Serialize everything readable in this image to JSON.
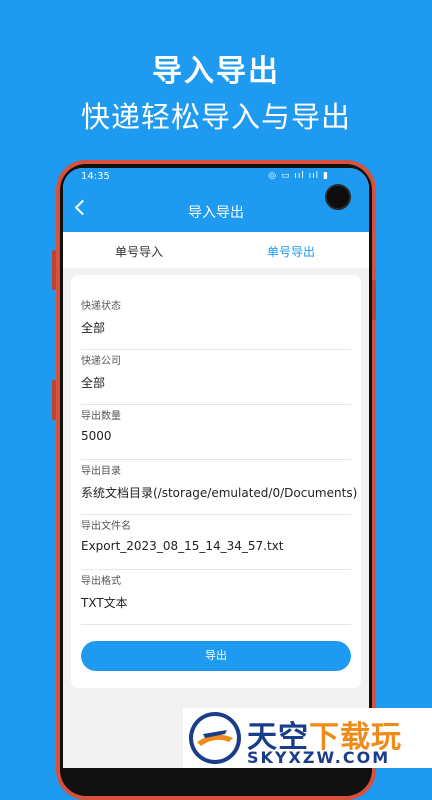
{
  "promo": {
    "title": "导入导出",
    "subtitle": "快递轻松导入与导出"
  },
  "status_bar": {
    "time": "14:35",
    "icons": "◎ ▭ ııl ııl ▮"
  },
  "nav": {
    "title": "导入导出",
    "back_icon": "chevron-left-icon"
  },
  "tabs": [
    {
      "label": "单号导入",
      "active": false
    },
    {
      "label": "单号导出",
      "active": true
    }
  ],
  "form": {
    "fields": [
      {
        "label": "快递状态",
        "value": "全部"
      },
      {
        "label": "快递公司",
        "value": "全部"
      },
      {
        "label": "导出数量",
        "value": "5000"
      },
      {
        "label": "导出目录",
        "value": "系统文档目录(/storage/emulated/0/Documents)"
      },
      {
        "label": "导出文件名",
        "value": "Export_2023_08_15_14_34_57.txt"
      },
      {
        "label": "导出格式",
        "value": "TXT文本"
      }
    ],
    "submit_label": "导出"
  },
  "watermark": {
    "title_main": "天空",
    "title_accent": "下载玩",
    "subtitle": "SKYXZW.COM"
  },
  "colors": {
    "accent": "#1E9BF0",
    "phone_frame": "#d9503c",
    "watermark_blue": "#1a3d8a",
    "watermark_orange": "#f08a1a"
  }
}
